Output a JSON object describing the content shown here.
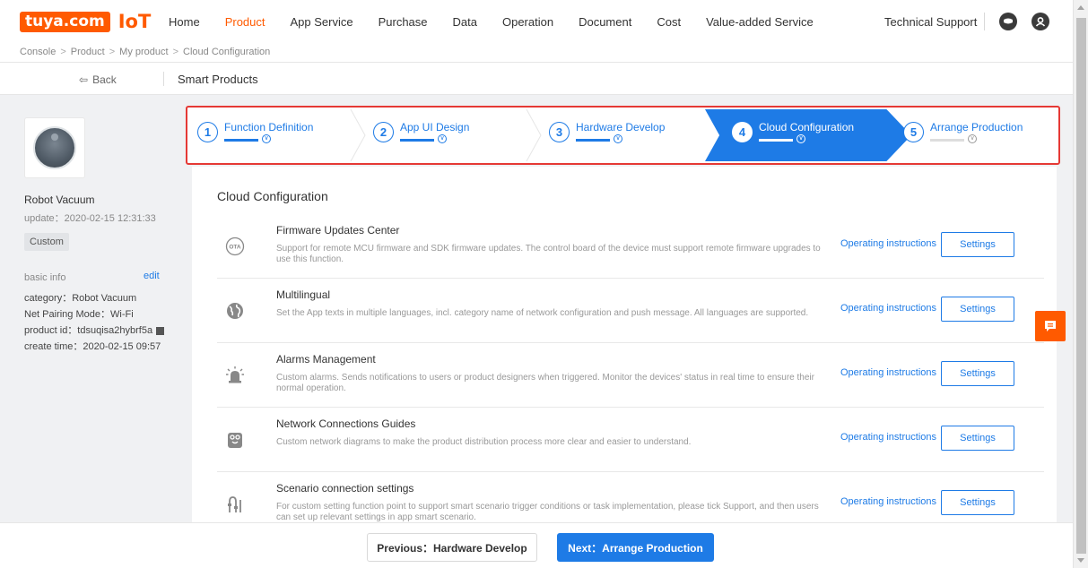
{
  "header": {
    "logo_brand": "tuya.com",
    "logo_product": "IoT",
    "nav": [
      {
        "label": "Home",
        "active": false
      },
      {
        "label": "Product",
        "active": true
      },
      {
        "label": "App Service",
        "active": false
      },
      {
        "label": "Purchase",
        "active": false
      },
      {
        "label": "Data",
        "active": false
      },
      {
        "label": "Operation",
        "active": false
      },
      {
        "label": "Document",
        "active": false
      },
      {
        "label": "Cost",
        "active": false
      },
      {
        "label": "Value-added Service",
        "active": false
      }
    ],
    "technical_support": "Technical Support",
    "icons": [
      "message-icon",
      "user-icon"
    ]
  },
  "breadcrumb": [
    "Console",
    "Product",
    "My product",
    "Cloud Configuration"
  ],
  "subbar": {
    "back_label": "Back",
    "title": "Smart Products"
  },
  "product": {
    "name": "Robot Vacuum",
    "update": "update：2020-02-15 12:31:33",
    "tag": "Custom",
    "basic_info_label": "basic info",
    "edit_label": "edit",
    "category": "category：Robot Vacuum",
    "pairing_mode": "Net Pairing Mode：Wi-Fi",
    "product_id": "product id：tdsuqisa2hybrf5a",
    "create_time": "create time：2020-02-15 09:57"
  },
  "steps": [
    {
      "num": "1",
      "label": "Function Definition",
      "state": "done"
    },
    {
      "num": "2",
      "label": "App UI Design",
      "state": "done"
    },
    {
      "num": "3",
      "label": "Hardware Develop",
      "state": "done"
    },
    {
      "num": "4",
      "label": "Cloud Configuration",
      "state": "active"
    },
    {
      "num": "5",
      "label": "Arrange Production",
      "state": "todo"
    }
  ],
  "content": {
    "title": "Cloud Configuration",
    "link_label": "Operating instructions",
    "button_label": "Settings",
    "features": [
      {
        "title": "Firmware Updates Center",
        "icon": "ota-icon",
        "desc": "Support for remote MCU firmware and SDK firmware updates. The control board of the device must support remote firmware upgrades to use this function."
      },
      {
        "title": "Multilingual",
        "icon": "globe-icon",
        "desc": "Set the App texts in multiple languages, incl. category name of network configuration and push message. All languages are supported."
      },
      {
        "title": "Alarms Management",
        "icon": "alarm-icon",
        "desc": "Custom alarms. Sends notifications to users or product designers when triggered. Monitor the devices' status in real time to ensure their normal operation."
      },
      {
        "title": "Network Connections Guides",
        "icon": "network-guide-icon",
        "desc": "Custom network diagrams to make the product distribution process more clear and easier to understand."
      },
      {
        "title": "Scenario connection settings",
        "icon": "scenario-icon",
        "desc": "For custom setting function point to support smart scenario trigger conditions or task implementation, please tick Support, and then users can set up relevant settings in app smart scenario."
      }
    ]
  },
  "footer": {
    "prev_label": "Previous：Hardware Develop",
    "next_label": "Next：Arrange Production"
  },
  "colors": {
    "brand": "#ff5a00",
    "primary": "#1e7be6",
    "highlight_border": "#e53935"
  }
}
